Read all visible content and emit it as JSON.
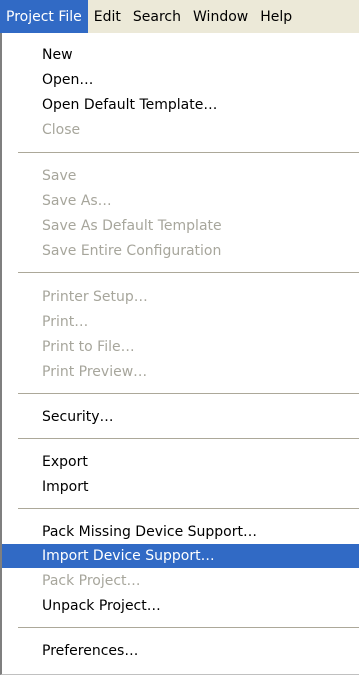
{
  "menubar": {
    "items": [
      "Project File",
      "Edit",
      "Search",
      "Window",
      "Help"
    ]
  },
  "menu": {
    "items": [
      {
        "label": "New",
        "enabled": true
      },
      {
        "label": "Open…",
        "enabled": true
      },
      {
        "label": "Open Default Template…",
        "enabled": true
      },
      {
        "label": "Close",
        "enabled": false
      },
      {
        "label": "Save",
        "enabled": false
      },
      {
        "label": "Save As…",
        "enabled": false
      },
      {
        "label": "Save As Default Template",
        "enabled": false
      },
      {
        "label": "Save Entire Configuration",
        "enabled": false
      },
      {
        "label": "Printer Setup…",
        "enabled": false
      },
      {
        "label": "Print…",
        "enabled": false
      },
      {
        "label": "Print to File…",
        "enabled": false
      },
      {
        "label": "Print Preview…",
        "enabled": false
      },
      {
        "label": "Security…",
        "enabled": true
      },
      {
        "label": "Export",
        "enabled": true
      },
      {
        "label": "Import",
        "enabled": true
      },
      {
        "label": "Pack Missing Device Support…",
        "enabled": true
      },
      {
        "label": "Import Device Support…",
        "enabled": true,
        "highlighted": true
      },
      {
        "label": "Pack Project…",
        "enabled": false
      },
      {
        "label": "Unpack Project…",
        "enabled": true
      },
      {
        "label": "Preferences…",
        "enabled": true
      }
    ]
  }
}
